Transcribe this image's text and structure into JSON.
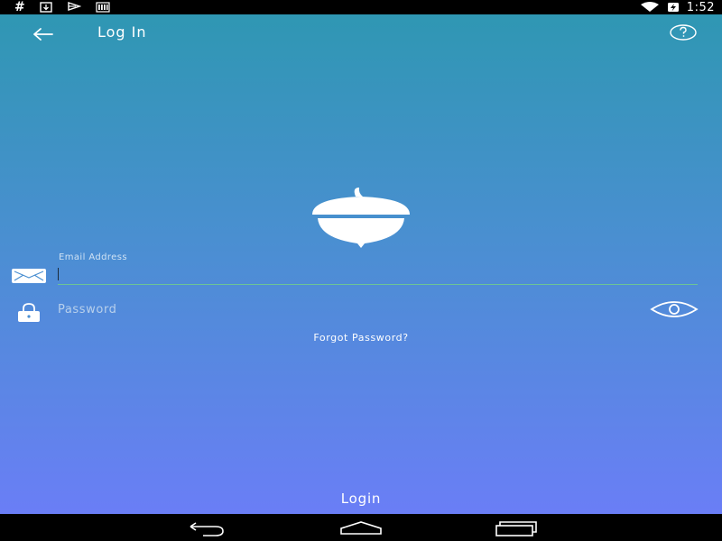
{
  "status_bar": {
    "left_icons": [
      "hash-icon",
      "download-icon",
      "flag-icon",
      "signal-bars-icon"
    ],
    "hash_text": "#",
    "right_icons": [
      "wifi-icon",
      "battery-charging-icon"
    ],
    "time": "1:52"
  },
  "header": {
    "title": "Log In",
    "back_icon": "arrow-left-icon",
    "help_icon": "question-mark-icon"
  },
  "logo": {
    "icon": "acorn-icon"
  },
  "form": {
    "email": {
      "label": "Email Address",
      "value": "",
      "icon": "envelope-icon"
    },
    "password": {
      "placeholder": "Password",
      "value": "",
      "icon": "lock-icon",
      "toggle_icon": "eye-icon"
    },
    "forgot_link": "Forgot Password?",
    "submit_label": "Login"
  },
  "nav_bar": {
    "buttons": [
      "back-nav-icon",
      "home-nav-icon",
      "recents-nav-icon"
    ]
  },
  "colors": {
    "gradient_top": "#2f97b3",
    "gradient_mid": "#4a8fd1",
    "gradient_bottom": "#6a7ef6",
    "underline_active": "#6cc496"
  }
}
